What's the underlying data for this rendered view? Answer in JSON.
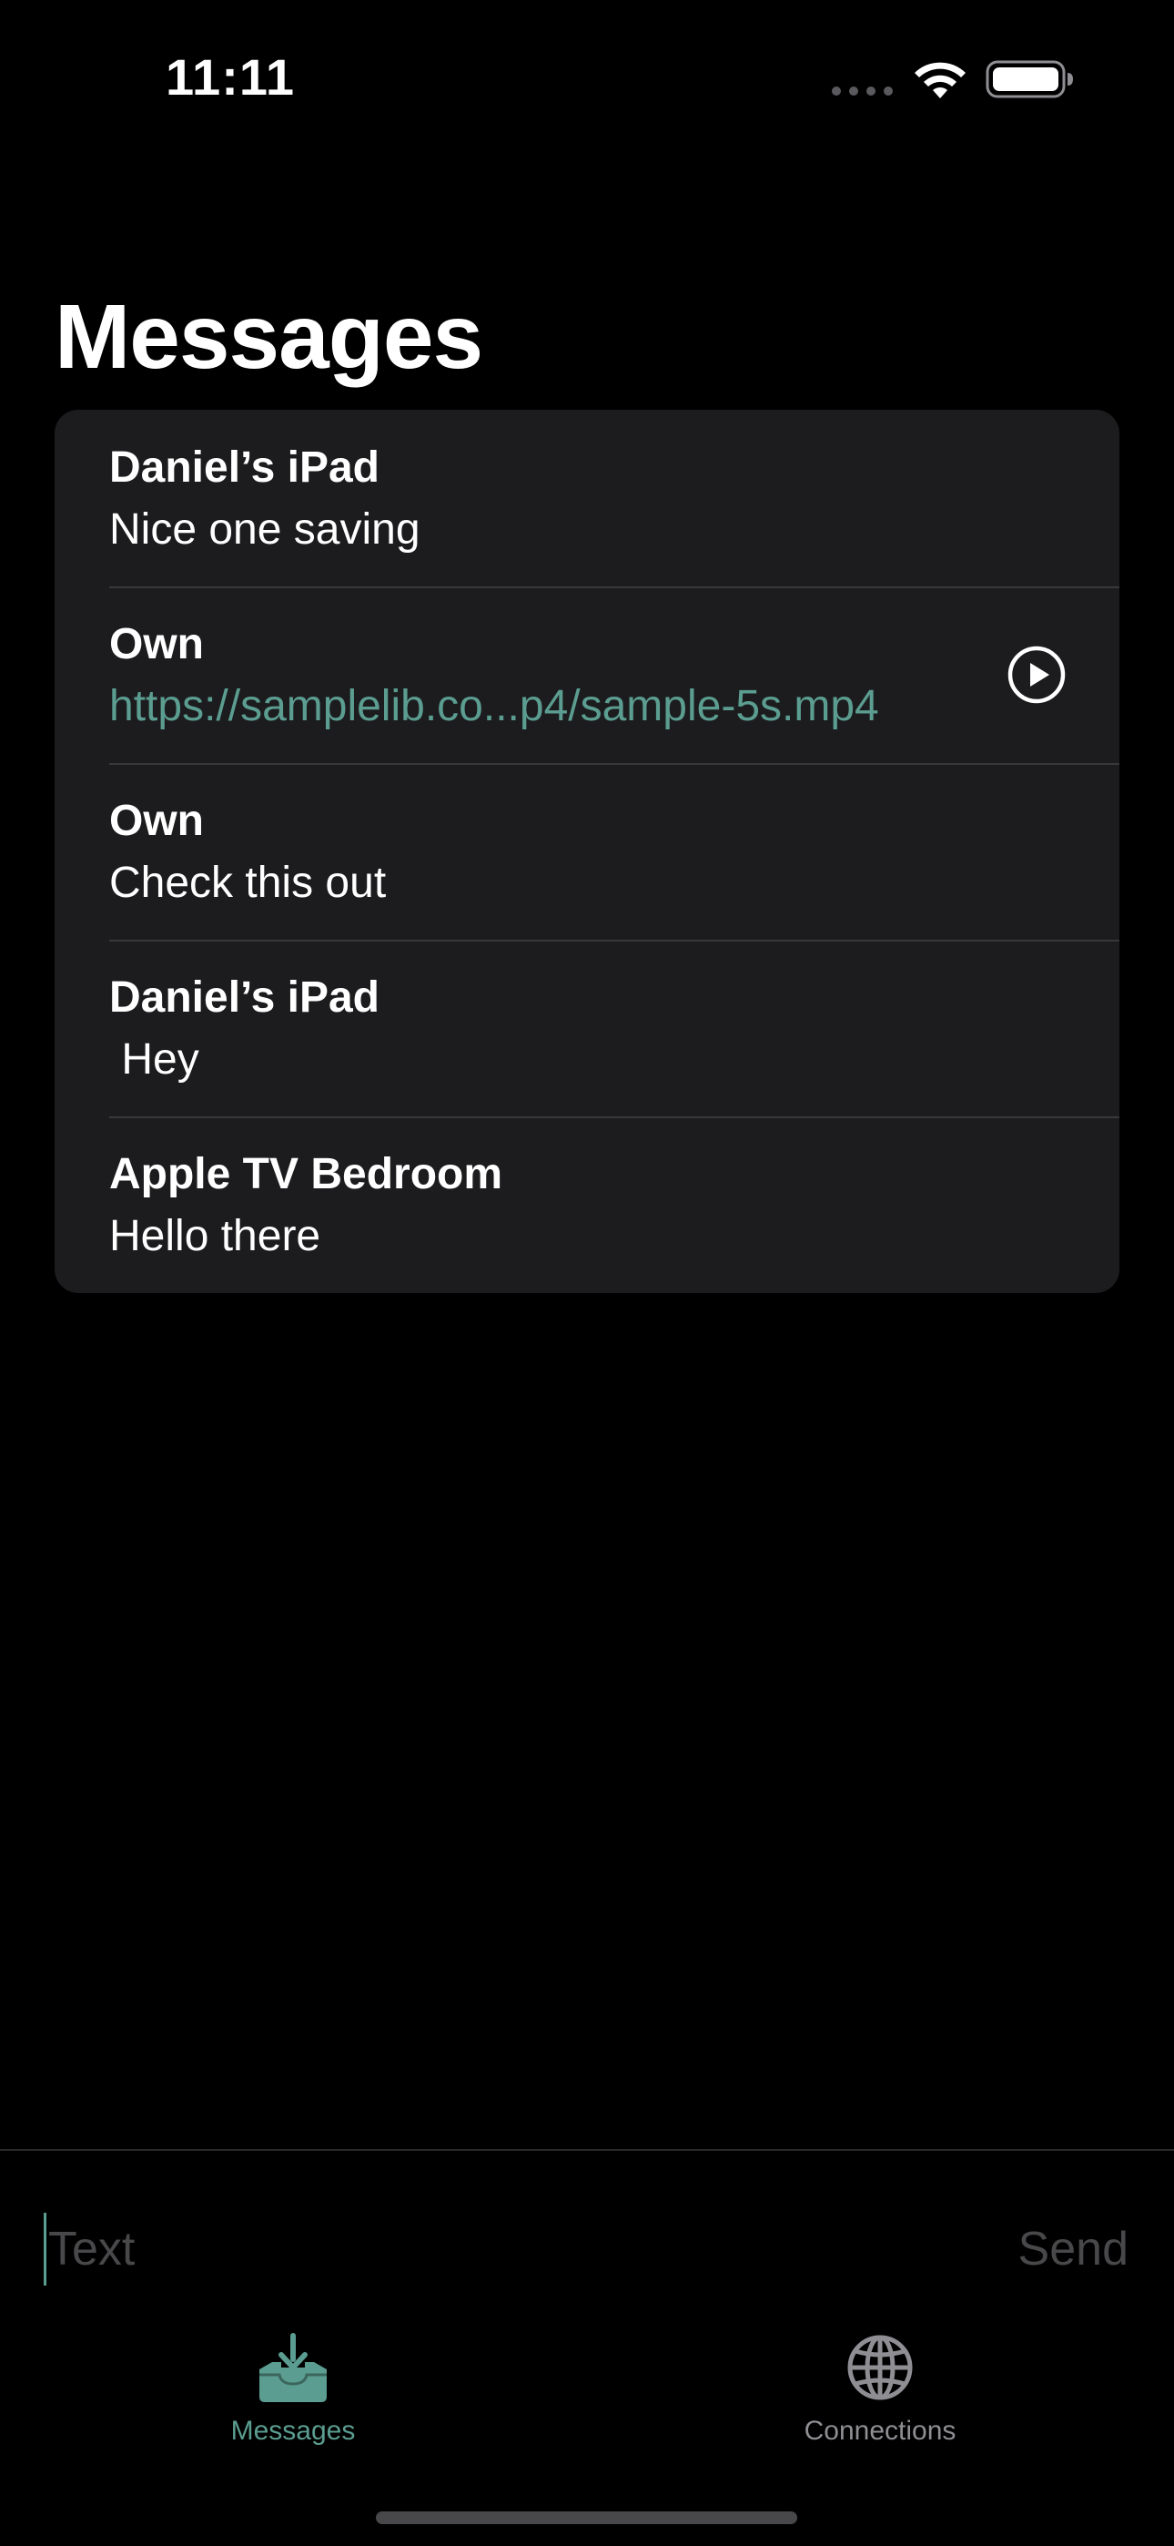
{
  "status_bar": {
    "time": "11:11",
    "icons": [
      "cellular-signal-icon",
      "wifi-icon",
      "battery-icon"
    ]
  },
  "page_title": "Messages",
  "messages": [
    {
      "sender": "Daniel’s iPad",
      "text": "Nice one saving",
      "is_link": false
    },
    {
      "sender": "Own",
      "text": "https://samplelib.co...p4/sample-5s.mp4",
      "is_link": true,
      "action_icon": "play-circle-icon"
    },
    {
      "sender": "Own",
      "text": "Check this out",
      "is_link": false
    },
    {
      "sender": "Daniel’s iPad",
      "text": " Hey",
      "is_link": false
    },
    {
      "sender": "Apple TV Bedroom",
      "text": "Hello there",
      "is_link": false
    }
  ],
  "composer": {
    "placeholder": "Text",
    "value": "",
    "send_label": "Send"
  },
  "tab_bar": {
    "tabs": [
      {
        "label": "Messages",
        "icon": "inbox-download-icon",
        "selected": true
      },
      {
        "label": "Connections",
        "icon": "globe-icon",
        "selected": false
      }
    ]
  },
  "colors": {
    "background": "#000000",
    "card": "#1c1c1e",
    "accent": "#5b9d90",
    "separator": "#38383a",
    "inactive": "#8e8e93",
    "placeholder": "#48484a"
  }
}
